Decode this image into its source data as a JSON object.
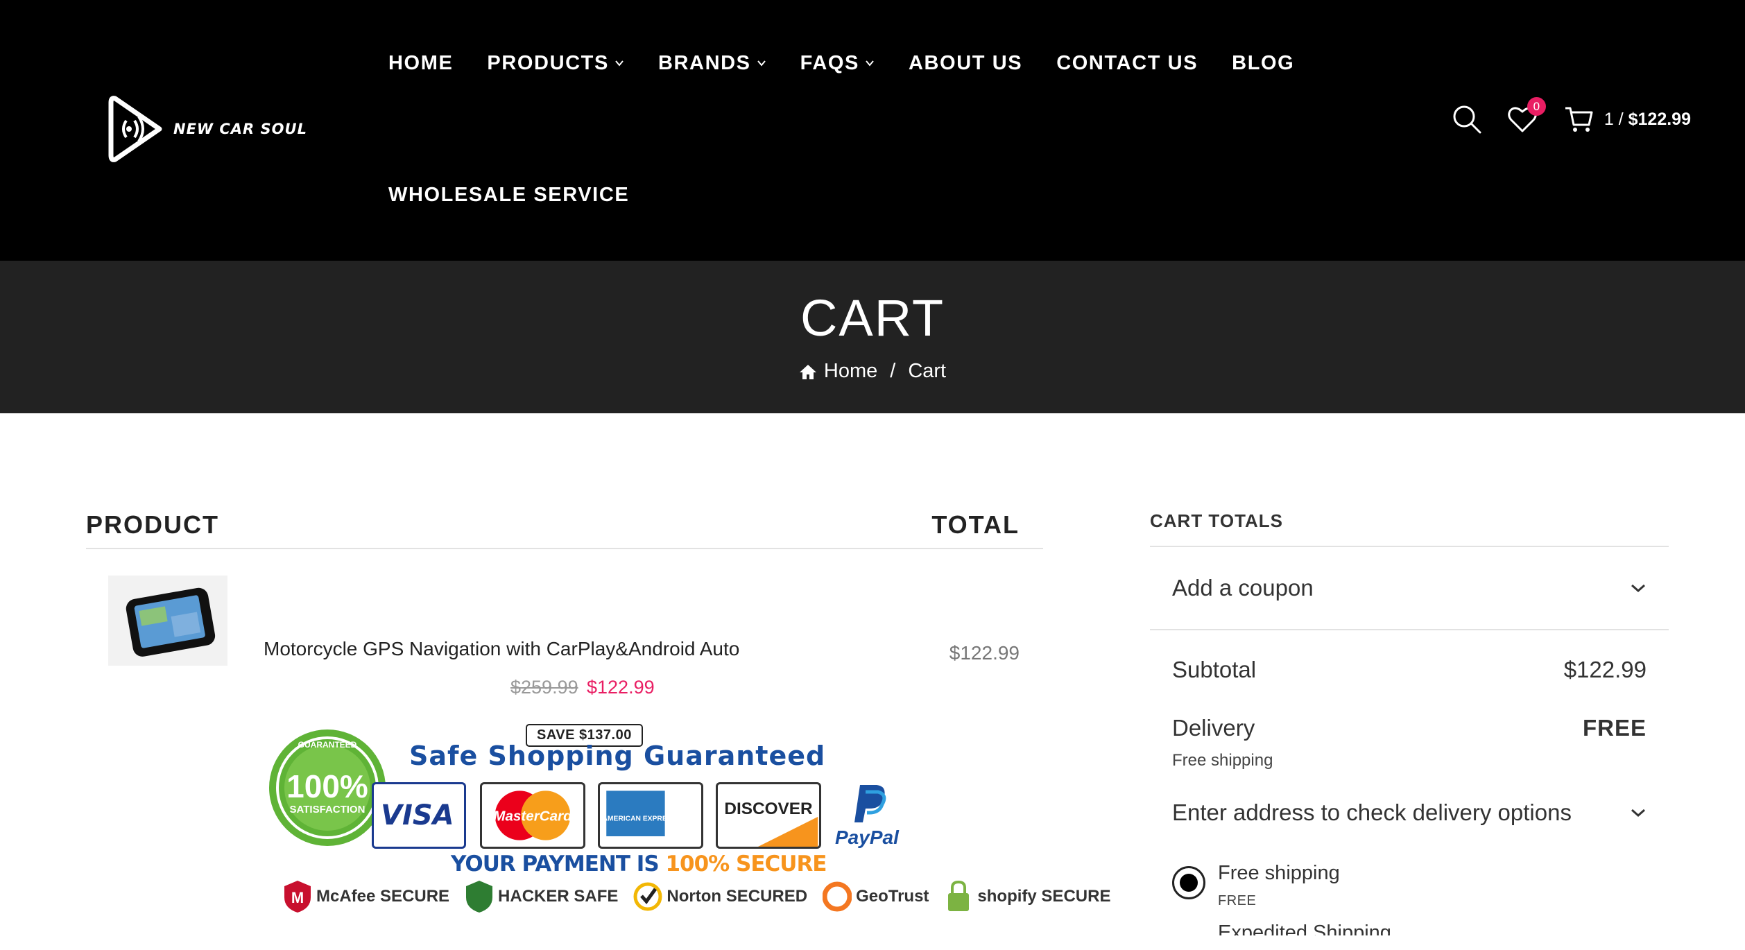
{
  "header": {
    "logo_text": "NEW CAR SOUL",
    "nav_row1": [
      {
        "label": "HOME",
        "dropdown": false
      },
      {
        "label": "PRODUCTS",
        "dropdown": true
      },
      {
        "label": "BRANDS",
        "dropdown": true
      },
      {
        "label": "FAQS",
        "dropdown": true
      },
      {
        "label": "ABOUT US",
        "dropdown": false
      },
      {
        "label": "CONTACT US",
        "dropdown": false
      },
      {
        "label": "BLOG",
        "dropdown": false
      }
    ],
    "nav_row2": [
      {
        "label": "WHOLESALE SERVICE",
        "dropdown": false
      }
    ],
    "wishlist_count": "0",
    "cart_count": "1 /",
    "cart_amount": "$122.99"
  },
  "title_bar": {
    "title": "CART",
    "breadcrumb_home": "Home",
    "breadcrumb_sep": "/",
    "breadcrumb_current": "Cart"
  },
  "table": {
    "col_product": "PRODUCT",
    "col_total": "TOTAL",
    "items": [
      {
        "name": "Motorcycle GPS Navigation with CarPlay&Android Auto",
        "price_old": "$259.99",
        "price_new": "$122.99",
        "save": "SAVE $137.00",
        "total": "$122.99"
      }
    ]
  },
  "trust": {
    "seal_big": "100%",
    "seal_word": "SATISFACTION",
    "seal_top": "GUARANTEED",
    "headline": "Safe Shopping Guaranteed",
    "cards": [
      "VISA",
      "MasterCard",
      "AMERICAN EXPRESS Cards",
      "DISCOVER"
    ],
    "paypal": "PayPal",
    "payment_a": "YOUR PAYMENT IS ",
    "payment_b": "100% SECURE",
    "secure_badges": [
      "McAfee SECURE",
      "HACKER SAFE",
      "Norton SECURED",
      "GeoTrust",
      "shopify SECURE"
    ]
  },
  "totals": {
    "title": "CART TOTALS",
    "coupon_label": "Add a coupon",
    "subtotal_label": "Subtotal",
    "subtotal_value": "$122.99",
    "delivery_label": "Delivery",
    "delivery_value": "FREE",
    "delivery_sub": "Free shipping",
    "address_label": "Enter address to check delivery options",
    "shipping_option_name": "Free shipping",
    "shipping_option_price": "FREE",
    "next_option_name": "Expedited Shipping"
  },
  "colors": {
    "header_bg": "#000000",
    "title_bar_bg": "#222222",
    "accent_pink": "#e91e63"
  }
}
